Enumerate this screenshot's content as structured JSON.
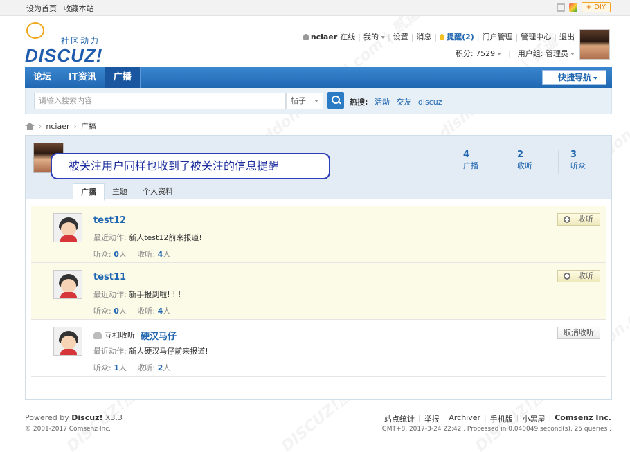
{
  "topbar": {
    "set_home": "设为首页",
    "bookmark": "收藏本站",
    "diy": "DIY"
  },
  "logo": {
    "slogan": "社区动力",
    "name": "DISCUZ!"
  },
  "user": {
    "name": "nciaer",
    "status": "在线",
    "my": "我的",
    "settings": "设置",
    "messages": "消息",
    "remind": "提醒(2)",
    "portal_admin": "门户管理",
    "admin_center": "管理中心",
    "logout": "退出",
    "points": "积分: 7529",
    "group": "用户组: 管理员"
  },
  "nav": {
    "items": [
      "论坛",
      "IT资讯",
      "广播"
    ],
    "quick": "快捷导航"
  },
  "search": {
    "placeholder": "请输入搜索内容",
    "type": "帖子",
    "hot_label": "热搜:",
    "hot_words": [
      "活动",
      "交友",
      "discuz"
    ]
  },
  "breadcrumb": [
    "nciaer",
    "广播"
  ],
  "profile": {
    "callout": "被关注用户同样也收到了被关注的信息提醒",
    "stats": [
      {
        "num": "4",
        "label": "广播"
      },
      {
        "num": "2",
        "label": "收听"
      },
      {
        "num": "3",
        "label": "听众"
      }
    ],
    "tabs": [
      "广播",
      "主题",
      "个人资料"
    ]
  },
  "list": [
    {
      "name": "test12",
      "action_label": "最近动作:",
      "action": "新人test12前来报道!",
      "fans_label": "听众:",
      "fans": "0",
      "fans_unit": "人",
      "follow_label": "收听:",
      "follow": "4",
      "follow_unit": "人",
      "button": "收听"
    },
    {
      "name": "test11",
      "action_label": "最近动作:",
      "action": "新手报到啦! ! !",
      "fans_label": "听众:",
      "fans": "0",
      "fans_unit": "人",
      "follow_label": "收听:",
      "follow": "4",
      "follow_unit": "人",
      "button": "收听"
    },
    {
      "mutual": "互相收听",
      "name": "硬汉马仔",
      "action_label": "最近动作:",
      "action": "新人硬汉马仔前来报道!",
      "fans_label": "听众:",
      "fans": "1",
      "fans_unit": "人",
      "follow_label": "收听:",
      "follow": "2",
      "follow_unit": "人",
      "button": "取消收听"
    }
  ],
  "footer": {
    "powered": "Powered by",
    "brand": "Discuz!",
    "version": "X3.3",
    "copyright": "© 2001-2017 Comsenz Inc.",
    "links": [
      "站点统计",
      "举报",
      "Archiver",
      "手机版",
      "小黑屋"
    ],
    "company": "Comsenz Inc.",
    "info": "GMT+8, 2017-3-24 22:42 , Processed in 0.040049 second(s), 25 queries ."
  },
  "watermark": "DISCUZ!应用中心 addon.dismall.com | 贰道"
}
